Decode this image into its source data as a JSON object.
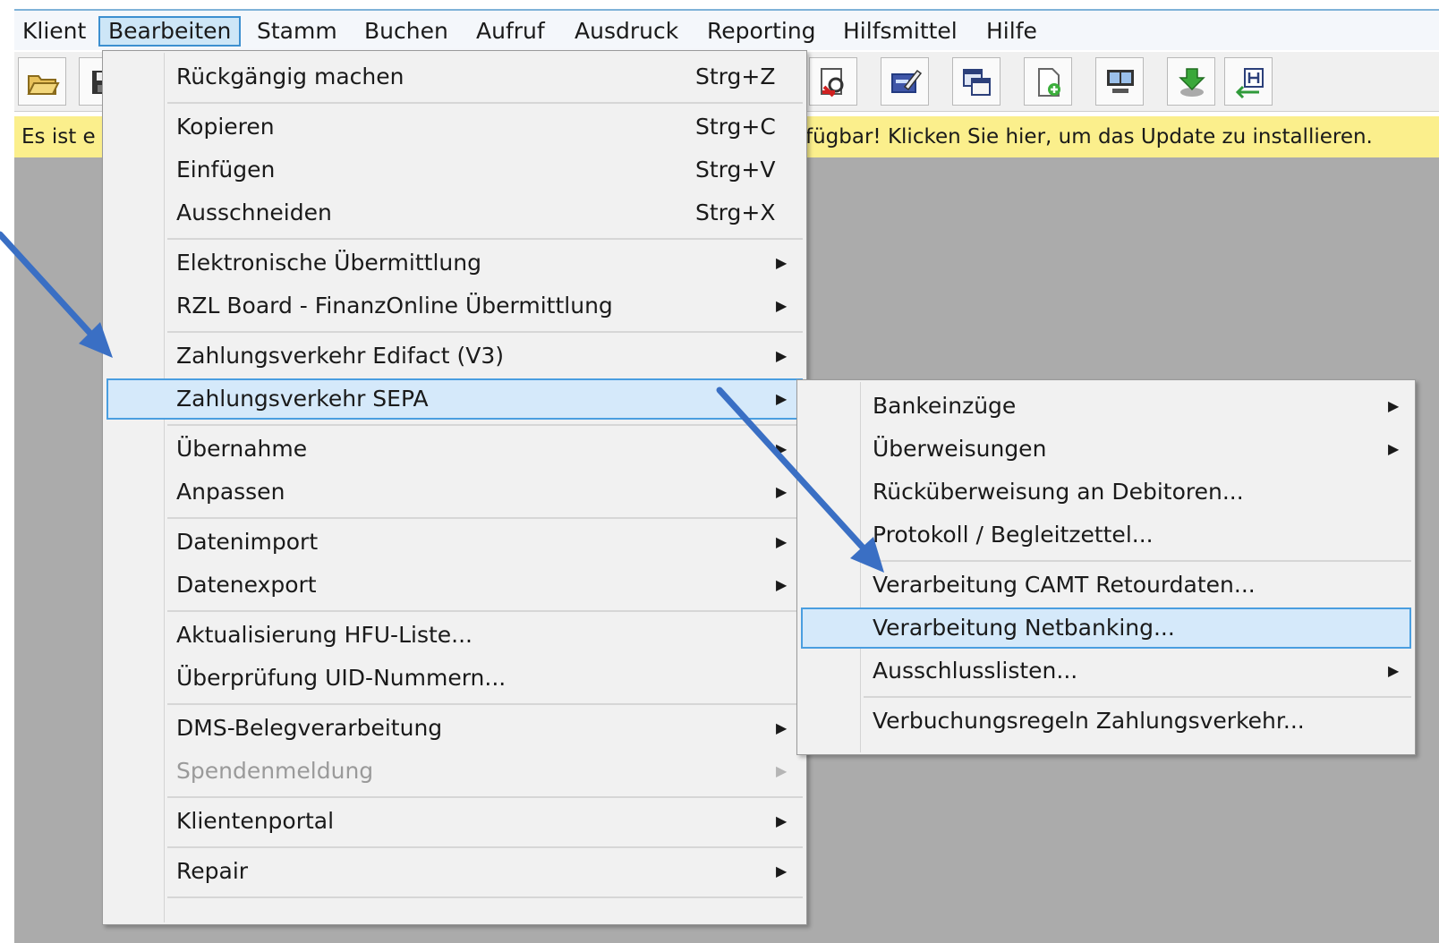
{
  "menubar": {
    "items": [
      "Klient",
      "Bearbeiten",
      "Stamm",
      "Buchen",
      "Aufruf",
      "Ausdruck",
      "Reporting",
      "Hilfsmittel",
      "Hilfe"
    ],
    "active": "Bearbeiten"
  },
  "toolbar": {
    "icons": [
      "open-folder-icon",
      "save-icon",
      "report-icon",
      "edit-form-icon",
      "copy-windows-icon",
      "new-document-icon",
      "monitor-compare-icon",
      "download-arrow-icon",
      "transfer-h-icon"
    ]
  },
  "update_bar": {
    "text_left": "Es ist e",
    "text_right": "fügbar! Klicken Sie hier, um das Update zu installieren."
  },
  "edit_menu": {
    "items": [
      {
        "label": "Rückgängig machen",
        "shortcut": "Strg+Z"
      },
      {
        "label": "Kopieren",
        "shortcut": "Strg+C"
      },
      {
        "label": "Einfügen",
        "shortcut": "Strg+V"
      },
      {
        "label": "Ausschneiden",
        "shortcut": "Strg+X"
      },
      {
        "label": "Elektronische Übermittlung",
        "shortcut": ""
      },
      {
        "label": "RZL Board - FinanzOnline Übermittlung",
        "shortcut": ""
      },
      {
        "label": "Zahlungsverkehr Edifact (V3)",
        "shortcut": ""
      },
      {
        "label": "Zahlungsverkehr SEPA",
        "shortcut": ""
      },
      {
        "label": "Übernahme",
        "shortcut": ""
      },
      {
        "label": "Anpassen",
        "shortcut": ""
      },
      {
        "label": "Datenimport",
        "shortcut": ""
      },
      {
        "label": "Datenexport",
        "shortcut": ""
      },
      {
        "label": "Aktualisierung HFU-Liste...",
        "shortcut": ""
      },
      {
        "label": "Überprüfung UID-Nummern...",
        "shortcut": ""
      },
      {
        "label": "DMS-Belegverarbeitung",
        "shortcut": ""
      },
      {
        "label": "Spendenmeldung",
        "shortcut": ""
      },
      {
        "label": "Klientenportal",
        "shortcut": ""
      },
      {
        "label": "Repair",
        "shortcut": ""
      }
    ]
  },
  "sepa_submenu": {
    "items": [
      {
        "label": "Bankeinzüge"
      },
      {
        "label": "Überweisungen"
      },
      {
        "label": "Rücküberweisung an Debitoren..."
      },
      {
        "label": "Protokoll / Begleitzettel..."
      },
      {
        "label": "Verarbeitung CAMT Retourdaten..."
      },
      {
        "label": "Verarbeitung Netbanking..."
      },
      {
        "label": "Ausschlusslisten..."
      },
      {
        "label": "Verbuchungsregeln Zahlungsverkehr..."
      }
    ]
  },
  "colors": {
    "highlight_fill": "#d5e9fa",
    "highlight_border": "#4a9ee0",
    "annotation_arrow": "#3a6fc4",
    "update_bar": "#fbef8c",
    "workspace": "#ababab"
  }
}
